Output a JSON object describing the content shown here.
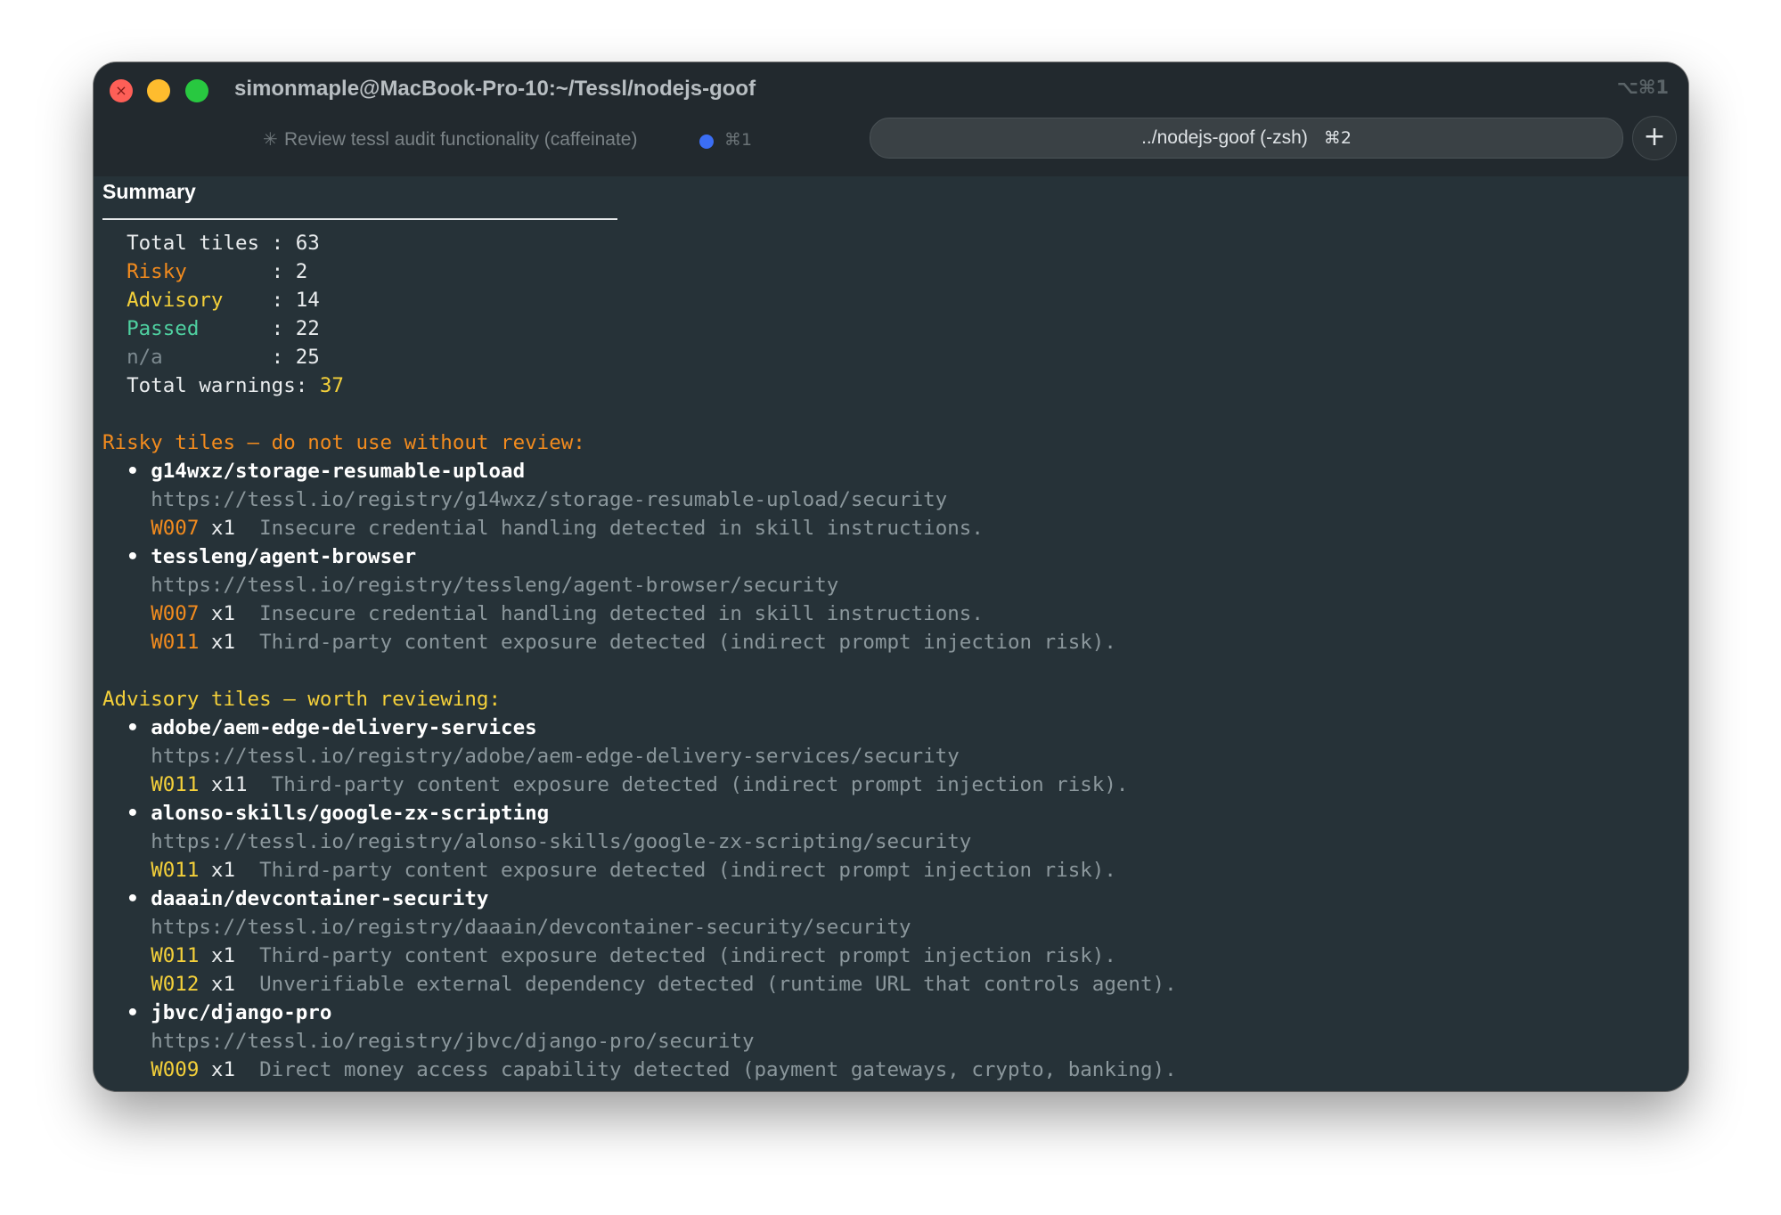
{
  "window": {
    "title": "simonmaple@MacBook-Pro-10:~/Tessl/nodejs-goof",
    "shortcut": "⌥⌘1",
    "close_glyph": "×"
  },
  "tabs": {
    "inactive": {
      "spark": "✳",
      "label": "Review tessl audit functionality (caffeinate)",
      "shortcut": "⌘1"
    },
    "active": {
      "label": "../nodejs-goof (-zsh)",
      "shortcut": "⌘2"
    },
    "new_tab": "+"
  },
  "summary": {
    "title": "Summary",
    "rows": [
      {
        "label": "Total tiles ",
        "sep": ": ",
        "value": "63"
      },
      {
        "label": "Risky       ",
        "sep": ": ",
        "value": "2"
      },
      {
        "label": "Advisory    ",
        "sep": ": ",
        "value": "14"
      },
      {
        "label": "Passed      ",
        "sep": ": ",
        "value": "22"
      },
      {
        "label": "n/a         ",
        "sep": ": ",
        "value": "25"
      },
      {
        "label": "Total warnings",
        "sep": ": ",
        "value": "37"
      }
    ]
  },
  "risky": {
    "heading": "Risky tiles — do not use without review:",
    "bullet": "•",
    "tiles": [
      {
        "name": "g14wxz/storage-resumable-upload",
        "url": "https://tessl.io/registry/g14wxz/storage-resumable-upload/security",
        "warnings": [
          {
            "code": "W007",
            "count": "x1",
            "text": "Insecure credential handling detected in skill instructions."
          }
        ]
      },
      {
        "name": "tessleng/agent-browser",
        "url": "https://tessl.io/registry/tessleng/agent-browser/security",
        "warnings": [
          {
            "code": "W007",
            "count": "x1",
            "text": "Insecure credential handling detected in skill instructions."
          },
          {
            "code": "W011",
            "count": "x1",
            "text": "Third-party content exposure detected (indirect prompt injection risk)."
          }
        ]
      }
    ]
  },
  "advisory": {
    "heading": "Advisory tiles — worth reviewing:",
    "bullet": "•",
    "tiles": [
      {
        "name": "adobe/aem-edge-delivery-services",
        "url": "https://tessl.io/registry/adobe/aem-edge-delivery-services/security",
        "warnings": [
          {
            "code": "W011",
            "count": "x11",
            "text": "Third-party content exposure detected (indirect prompt injection risk)."
          }
        ]
      },
      {
        "name": "alonso-skills/google-zx-scripting",
        "url": "https://tessl.io/registry/alonso-skills/google-zx-scripting/security",
        "warnings": [
          {
            "code": "W011",
            "count": "x1",
            "text": "Third-party content exposure detected (indirect prompt injection risk)."
          }
        ]
      },
      {
        "name": "daaain/devcontainer-security",
        "url": "https://tessl.io/registry/daaain/devcontainer-security/security",
        "warnings": [
          {
            "code": "W011",
            "count": "x1",
            "text": "Third-party content exposure detected (indirect prompt injection risk)."
          },
          {
            "code": "W012",
            "count": "x1",
            "text": "Unverifiable external dependency detected (runtime URL that controls agent)."
          }
        ]
      },
      {
        "name": "jbvc/django-pro",
        "url": "https://tessl.io/registry/jbvc/django-pro/security",
        "warnings": [
          {
            "code": "W009",
            "count": "x1",
            "text": "Direct money access capability detected (payment gateways, crypto, banking)."
          }
        ]
      }
    ]
  },
  "colors": {
    "background": "#263238",
    "risky": "#f28b1e",
    "advisory": "#f4d03a",
    "passed": "#4fd1a1",
    "na": "#7d8a90",
    "text": "#e9ecee"
  }
}
